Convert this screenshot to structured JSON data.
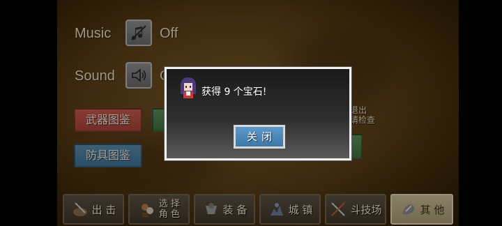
{
  "settings": {
    "music_label": "Music",
    "music_value": "Off",
    "sound_label": "Sound",
    "sound_value": "O"
  },
  "buttons": {
    "weapon_catalog": "武器图鉴",
    "armor_catalog": "防具图鉴"
  },
  "side_note": {
    "line1": "退出",
    "line2": "请检查"
  },
  "nav": [
    {
      "label": "出 击",
      "icon": "sortie-icon"
    },
    {
      "label_top": "选 择",
      "label_bottom": "角 色",
      "icon": "character-select-icon"
    },
    {
      "label": "装 备",
      "icon": "equipment-icon"
    },
    {
      "label": "城 镇",
      "icon": "town-icon"
    },
    {
      "label": "斗技场",
      "icon": "arena-icon"
    },
    {
      "label": "其 他",
      "icon": "other-icon",
      "active": true
    }
  ],
  "dialog": {
    "message": "获得 9 个宝石!",
    "close_label": "关闭"
  },
  "colors": {
    "dialog_border": "#f2f2f2",
    "close_button": "#4a86b8",
    "red_button": "#b84e42",
    "blue_button": "#4a80a2"
  }
}
